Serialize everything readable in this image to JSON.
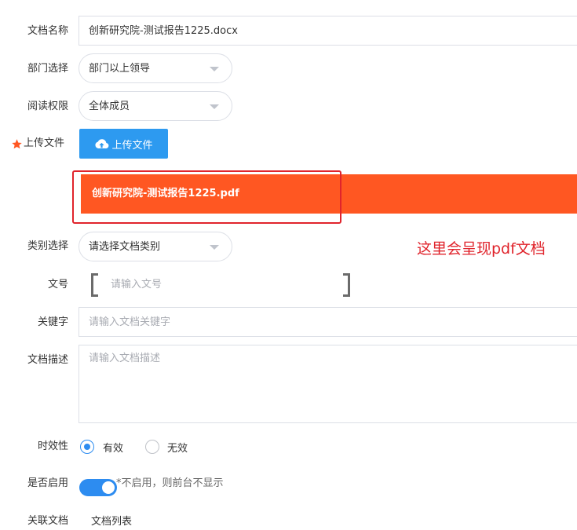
{
  "form": {
    "doc_name_label": "文档名称",
    "doc_name_value": "创新研究院-测试报告1225.docx",
    "dept_label": "部门选择",
    "dept_value": "部门以上领导",
    "read_label": "阅读权限",
    "read_value": "全体成员",
    "upload_label": "上传文件",
    "upload_button": "上传文件",
    "uploaded_file": "创新研究院-测试报告1225.pdf",
    "category_label": "类别选择",
    "category_value": "请选择文档类别",
    "annotation": "这里会呈现pdf文档",
    "docno_label": "文号",
    "docno_placeholder": "请输入文号",
    "keyword_label": "关键字",
    "keyword_placeholder": "请输入文档关键字",
    "desc_label": "文档描述",
    "desc_placeholder": "请输入文档描述",
    "validity_label": "时效性",
    "validity_options": [
      "有效",
      "无效"
    ],
    "validity_selected": "有效",
    "enable_label": "是否启用",
    "enable_hint": "*不启用，则前台不显示",
    "enable_on": true,
    "related_label": "关联文档",
    "related_link": "文档列表"
  },
  "colors": {
    "primary": "#2d8cf0",
    "upload_button": "#2d9af0",
    "file_bar": "#ff5722",
    "highlight_box": "#e0242c",
    "annotation_text": "#e0242c",
    "required_star": "#ff5722"
  },
  "icons": {
    "required": "star-icon",
    "upload": "cloud-upload-icon",
    "select_arrow": "caret-down-icon"
  }
}
